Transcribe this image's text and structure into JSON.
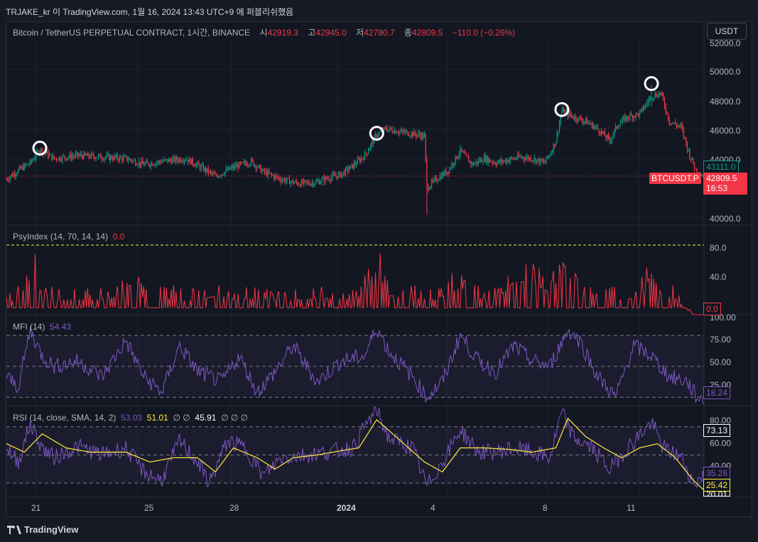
{
  "caption": "TRJAKE_kr 이 TradingView.com, 1월 16, 2024 13:43 UTC+9 에 퍼블리쉬했음",
  "brand": "TradingView",
  "currency_button": "USDT",
  "main_legend": {
    "symbol": "Bitcoin / TetherUS PERPETUAL CONTRACT, 1시간, BINANCE",
    "o_label": "시",
    "o_value": "42919.3",
    "h_label": "고",
    "h_value": "42945.0",
    "l_label": "저",
    "l_value": "42780.7",
    "c_label": "종",
    "c_value": "42809.5",
    "change": "−110.0 (−0.26%)"
  },
  "psy_legend": {
    "name": "PsyIndex (14, 70, 14, 14)",
    "value": "0.0"
  },
  "mfi_legend": {
    "name": "MFI (14)",
    "value": "54.43"
  },
  "rsi_legend": {
    "name": "RSI (14, close, SMA, 14, 2)",
    "v1": "53.03",
    "v2": "51.01",
    "empty1": "∅ ∅",
    "v3": "45.91",
    "empty2": "∅ ∅ ∅"
  },
  "price_axis": [
    "52000.0",
    "50000.0",
    "48000.0",
    "46000.0",
    "44000.0",
    "40000.0"
  ],
  "psy_axis": [
    "80.0",
    "40.0"
  ],
  "mfi_axis": [
    "100.00",
    "75.00",
    "50.00",
    "25.00"
  ],
  "rsi_axis": [
    "80.00",
    "60.00",
    "40.00",
    "20.01"
  ],
  "tags": {
    "price_green": "43111.0",
    "symbol_tag": "BTCUSDT.P",
    "price_last": "42809.5",
    "countdown": "16:53",
    "psy_last": "0.0",
    "mfi_last": "18.24",
    "rsi_top": "73.13",
    "rsi_purple": "35.26",
    "rsi_yellow": "25.42"
  },
  "time_axis": [
    "21",
    "25",
    "28",
    "2024",
    "4",
    "8",
    "11"
  ],
  "colors": {
    "up": "#089981",
    "down": "#f23645",
    "psy": "#f23645",
    "mfi": "#7e57c2",
    "rsi": "#7e57c2",
    "rsi_ma": "#ffeb3b",
    "bg": "#131722"
  },
  "chart_data": [
    {
      "type": "candlestick",
      "title": "Bitcoin / TetherUS PERPETUAL CONTRACT, 1시간, BINANCE",
      "ylim": [
        39500,
        52000
      ],
      "x_ticks": [
        "21",
        "25",
        "28",
        "2024",
        "4",
        "8",
        "11"
      ],
      "close_path": [
        [
          0,
          42600
        ],
        [
          10,
          43200
        ],
        [
          20,
          43700
        ],
        [
          28,
          44600
        ],
        [
          40,
          44000
        ],
        [
          60,
          44200
        ],
        [
          80,
          44100
        ],
        [
          100,
          44000
        ],
        [
          115,
          43600
        ],
        [
          130,
          43800
        ],
        [
          150,
          44000
        ],
        [
          165,
          43300
        ],
        [
          175,
          42800
        ],
        [
          190,
          43400
        ],
        [
          205,
          43800
        ],
        [
          215,
          43100
        ],
        [
          230,
          42600
        ],
        [
          245,
          42300
        ],
        [
          260,
          42400
        ],
        [
          270,
          42700
        ],
        [
          280,
          42900
        ],
        [
          290,
          43500
        ],
        [
          300,
          44200
        ],
        [
          310,
          45600
        ],
        [
          318,
          46000
        ],
        [
          330,
          45800
        ],
        [
          345,
          45600
        ],
        [
          350,
          45500
        ],
        [
          352,
          42000
        ],
        [
          360,
          42600
        ],
        [
          370,
          43200
        ],
        [
          380,
          44500
        ],
        [
          390,
          43600
        ],
        [
          400,
          44000
        ],
        [
          410,
          43700
        ],
        [
          420,
          43900
        ],
        [
          430,
          44100
        ],
        [
          440,
          44000
        ],
        [
          450,
          43700
        ],
        [
          455,
          44300
        ],
        [
          460,
          45200
        ],
        [
          465,
          47200
        ],
        [
          475,
          46800
        ],
        [
          485,
          46500
        ],
        [
          495,
          46000
        ],
        [
          505,
          45200
        ],
        [
          512,
          46300
        ],
        [
          520,
          46800
        ],
        [
          530,
          47000
        ],
        [
          540,
          48200
        ],
        [
          548,
          48400
        ],
        [
          555,
          46500
        ],
        [
          565,
          46100
        ],
        [
          572,
          44200
        ],
        [
          578,
          43100
        ],
        [
          584,
          42800
        ]
      ],
      "wick_extremes": {
        "low": 40200,
        "high": 48950
      },
      "highlight_circles_at": [
        [
          28,
          44600
        ],
        [
          310,
          45600
        ],
        [
          465,
          47200
        ],
        [
          540,
          48950
        ]
      ],
      "last_price": 42809.5
    },
    {
      "type": "line",
      "title": "PsyIndex (14, 70, 14, 14)",
      "ylim": [
        0,
        90
      ],
      "threshold": 70,
      "spike_points": [
        [
          0,
          22
        ],
        [
          10,
          30
        ],
        [
          22,
          75
        ],
        [
          28,
          45
        ],
        [
          40,
          28
        ],
        [
          60,
          28
        ],
        [
          80,
          28
        ],
        [
          100,
          38
        ],
        [
          100,
          60
        ],
        [
          115,
          30
        ],
        [
          130,
          28
        ],
        [
          140,
          30
        ],
        [
          150,
          25
        ],
        [
          165,
          30
        ],
        [
          180,
          35
        ],
        [
          190,
          28
        ],
        [
          210,
          30
        ],
        [
          230,
          25
        ],
        [
          250,
          28
        ],
        [
          270,
          30
        ],
        [
          290,
          28
        ],
        [
          300,
          40
        ],
        [
          308,
          80
        ],
        [
          315,
          60
        ],
        [
          320,
          35
        ],
        [
          340,
          30
        ],
        [
          360,
          28
        ],
        [
          380,
          50
        ],
        [
          395,
          30
        ],
        [
          410,
          28
        ],
        [
          425,
          60
        ],
        [
          440,
          60
        ],
        [
          455,
          40
        ],
        [
          465,
          75
        ],
        [
          470,
          50
        ],
        [
          490,
          30
        ],
        [
          510,
          28
        ],
        [
          530,
          30
        ],
        [
          540,
          75
        ],
        [
          548,
          40
        ],
        [
          560,
          28
        ],
        [
          575,
          0
        ],
        [
          584,
          0
        ]
      ],
      "last": 0.0
    },
    {
      "type": "line",
      "title": "MFI (14)",
      "ylim": [
        12,
        100
      ],
      "bands": [
        20,
        50,
        80
      ],
      "points": [
        [
          0,
          40
        ],
        [
          10,
          30
        ],
        [
          20,
          85
        ],
        [
          30,
          60
        ],
        [
          40,
          50
        ],
        [
          60,
          55
        ],
        [
          80,
          40
        ],
        [
          100,
          75
        ],
        [
          115,
          40
        ],
        [
          130,
          25
        ],
        [
          145,
          70
        ],
        [
          160,
          45
        ],
        [
          180,
          35
        ],
        [
          195,
          60
        ],
        [
          210,
          25
        ],
        [
          225,
          45
        ],
        [
          240,
          70
        ],
        [
          260,
          35
        ],
        [
          280,
          55
        ],
        [
          300,
          60
        ],
        [
          310,
          88
        ],
        [
          320,
          65
        ],
        [
          340,
          40
        ],
        [
          352,
          20
        ],
        [
          365,
          35
        ],
        [
          380,
          80
        ],
        [
          395,
          55
        ],
        [
          410,
          45
        ],
        [
          425,
          70
        ],
        [
          440,
          55
        ],
        [
          455,
          50
        ],
        [
          470,
          85
        ],
        [
          480,
          75
        ],
        [
          495,
          40
        ],
        [
          510,
          20
        ],
        [
          525,
          70
        ],
        [
          540,
          60
        ],
        [
          555,
          40
        ],
        [
          570,
          35
        ],
        [
          578,
          20
        ],
        [
          584,
          18
        ]
      ],
      "last": 18.24
    },
    {
      "type": "line",
      "title": "RSI (14, close, SMA, 14, 2)",
      "ylim": [
        20,
        85
      ],
      "bands": [
        30,
        50,
        70
      ],
      "series": [
        {
          "values": [
            [
              0,
              55
            ],
            [
              10,
              45
            ],
            [
              20,
              72
            ],
            [
              30,
              55
            ],
            [
              40,
              48
            ],
            [
              60,
              56
            ],
            [
              80,
              50
            ],
            [
              100,
              55
            ],
            [
              115,
              38
            ],
            [
              130,
              32
            ],
            [
              145,
              60
            ],
            [
              160,
              45
            ],
            [
              170,
              30
            ],
            [
              185,
              60
            ],
            [
              200,
              55
            ],
            [
              215,
              35
            ],
            [
              230,
              48
            ],
            [
              250,
              50
            ],
            [
              270,
              52
            ],
            [
              290,
              55
            ],
            [
              300,
              70
            ],
            [
              310,
              82
            ],
            [
              320,
              62
            ],
            [
              340,
              55
            ],
            [
              352,
              28
            ],
            [
              365,
              45
            ],
            [
              380,
              68
            ],
            [
              395,
              52
            ],
            [
              410,
              52
            ],
            [
              425,
              55
            ],
            [
              440,
              52
            ],
            [
              455,
              48
            ],
            [
              465,
              80
            ],
            [
              475,
              62
            ],
            [
              490,
              55
            ],
            [
              505,
              40
            ],
            [
              520,
              55
            ],
            [
              540,
              73
            ],
            [
              550,
              55
            ],
            [
              565,
              48
            ],
            [
              575,
              30
            ],
            [
              584,
              35
            ]
          ]
        },
        {
          "values": [
            [
              0,
              58
            ],
            [
              15,
              52
            ],
            [
              30,
              65
            ],
            [
              50,
              55
            ],
            [
              70,
              52
            ],
            [
              100,
              52
            ],
            [
              120,
              45
            ],
            [
              140,
              48
            ],
            [
              160,
              48
            ],
            [
              175,
              38
            ],
            [
              190,
              55
            ],
            [
              210,
              48
            ],
            [
              225,
              40
            ],
            [
              240,
              48
            ],
            [
              260,
              50
            ],
            [
              280,
              53
            ],
            [
              295,
              55
            ],
            [
              310,
              75
            ],
            [
              330,
              60
            ],
            [
              350,
              45
            ],
            [
              365,
              38
            ],
            [
              380,
              55
            ],
            [
              400,
              55
            ],
            [
              420,
              54
            ],
            [
              440,
              52
            ],
            [
              460,
              55
            ],
            [
              470,
              76
            ],
            [
              485,
              63
            ],
            [
              500,
              55
            ],
            [
              515,
              48
            ],
            [
              530,
              55
            ],
            [
              545,
              58
            ],
            [
              560,
              48
            ],
            [
              575,
              32
            ],
            [
              584,
              25
            ]
          ]
        }
      ]
    }
  ]
}
